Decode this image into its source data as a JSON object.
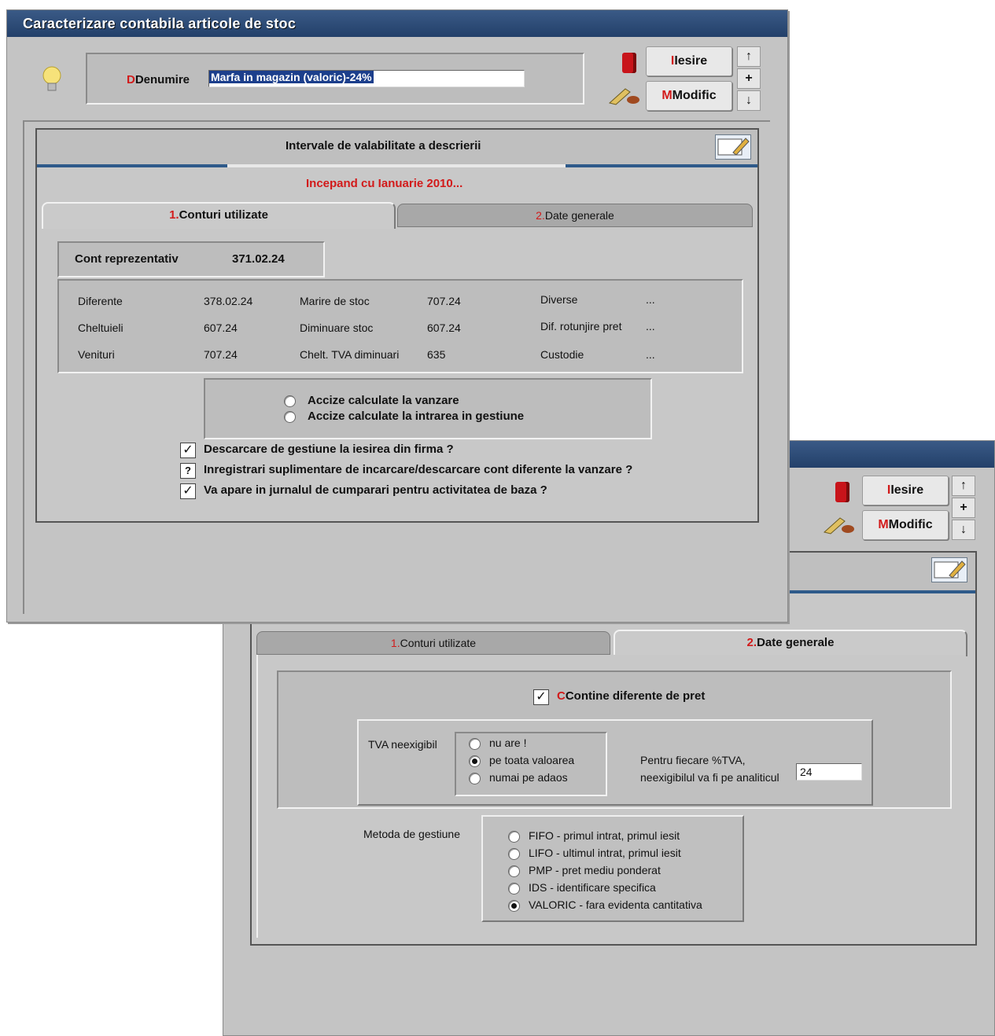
{
  "window1": {
    "title": "Caracterizare contabila articole de stoc",
    "denumire_label": "Denumire",
    "denumire_value": "Marfa in magazin (valoric)-24%",
    "btn_iesire": "Iesire",
    "btn_modific": "Modific",
    "arrow_up": "↑",
    "arrow_plus": "+",
    "arrow_down": "↓",
    "intervale_title": "Intervale de valabilitate a descrierii",
    "incepand": "Incepand cu Ianuarie 2010...",
    "tab1": "Conturi utilizate",
    "tab1_num": "1.",
    "tab2": "Date generale",
    "tab2_num": "2.",
    "cont_repr_label": "Cont reprezentativ",
    "cont_repr_value": "371.02.24",
    "accounts": {
      "diferente_label": "Diferente",
      "diferente_value": "378.02.24",
      "cheltuieli_label": "Cheltuieli",
      "cheltuieli_value": "607.24",
      "venituri_label": "Venituri",
      "venituri_value": "707.24",
      "marire_label": "Marire de stoc",
      "marire_value": "707.24",
      "diminuare_label": "Diminuare stoc",
      "diminuare_value": "607.24",
      "chelt_tva_label": "Chelt. TVA diminuari",
      "chelt_tva_value": "635",
      "diverse_label": "Diverse",
      "diverse_value": "...",
      "dif_rotunjire_label": "Dif. rotunjire pret",
      "dif_rotunjire_value": "...",
      "custodie_label": "Custodie",
      "custodie_value": "..."
    },
    "accize_vanzare": "Accize calculate la vanzare",
    "accize_intrare": "Accize calculate la intrarea in gestiune",
    "chk1_label": "Descarcare de gestiune la iesirea din firma ?",
    "chk1_mark": "✓",
    "chk2_label": "Inregistrari suplimentare de incarcare/descarcare cont diferente la vanzare ?",
    "chk2_mark": "?",
    "chk3_label": "Va apare in jurnalul de cumparari pentru activitatea de baza ?",
    "chk3_mark": "✓"
  },
  "window2": {
    "btn_iesire": "Iesire",
    "btn_modific": "Modific",
    "arrow_up": "↑",
    "arrow_plus": "+",
    "arrow_down": "↓",
    "tab1": "Conturi utilizate",
    "tab1_num": "1.",
    "tab2": "Date generale",
    "tab2_num": "2.",
    "contine_label": "Contine diferente de pret",
    "contine_mark": "✓",
    "tva_label": "TVA neexigibil",
    "tva_options": [
      "nu are !",
      "pe toata valoarea",
      "numai pe adaos"
    ],
    "tva_selected": "pe toata valoarea",
    "pentru_line1": "Pentru fiecare %TVA,",
    "pentru_line2": "neexigibilul va fi pe analiticul",
    "pentru_value": "24",
    "metoda_label": "Metoda de gestiune",
    "metoda_options": [
      "FIFO - primul intrat, primul iesit",
      "LIFO - ultimul intrat, primul iesit",
      "PMP - pret mediu ponderat",
      "IDS - identificare specifica",
      "VALORIC - fara evidenta cantitativa"
    ],
    "metoda_selected": "VALORIC - fara evidenta cantitativa"
  }
}
